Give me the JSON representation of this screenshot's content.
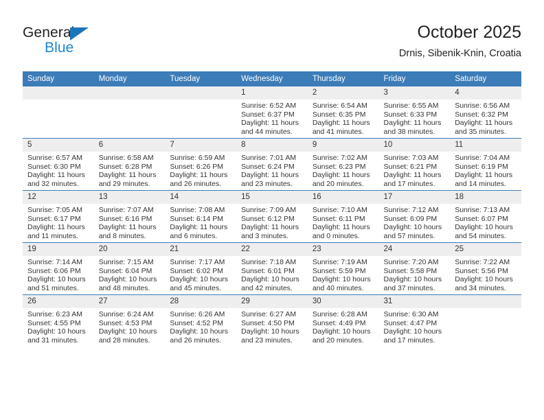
{
  "brand": {
    "name_part1": "General",
    "name_part2": "Blue",
    "triangle_color": "#1b75bb",
    "blue_color": "#1b86d6"
  },
  "header": {
    "title": "October 2025",
    "location": "Drnis, Sibenik-Knin, Croatia"
  },
  "theme": {
    "header_bg": "#3c7cb8",
    "daynum_bg": "#eeeeee",
    "row_border": "#3c7cb8",
    "text": "#333333"
  },
  "weekday_headers": [
    "Sunday",
    "Monday",
    "Tuesday",
    "Wednesday",
    "Thursday",
    "Friday",
    "Saturday"
  ],
  "labels": {
    "sunrise": "Sunrise:",
    "sunset": "Sunset:",
    "daylight": "Daylight:"
  },
  "weeks": [
    [
      {
        "day": "",
        "sunrise": "",
        "sunset": "",
        "daylight": ""
      },
      {
        "day": "",
        "sunrise": "",
        "sunset": "",
        "daylight": ""
      },
      {
        "day": "",
        "sunrise": "",
        "sunset": "",
        "daylight": ""
      },
      {
        "day": "1",
        "sunrise": "Sunrise: 6:52 AM",
        "sunset": "Sunset: 6:37 PM",
        "daylight": "Daylight: 11 hours and 44 minutes."
      },
      {
        "day": "2",
        "sunrise": "Sunrise: 6:54 AM",
        "sunset": "Sunset: 6:35 PM",
        "daylight": "Daylight: 11 hours and 41 minutes."
      },
      {
        "day": "3",
        "sunrise": "Sunrise: 6:55 AM",
        "sunset": "Sunset: 6:33 PM",
        "daylight": "Daylight: 11 hours and 38 minutes."
      },
      {
        "day": "4",
        "sunrise": "Sunrise: 6:56 AM",
        "sunset": "Sunset: 6:32 PM",
        "daylight": "Daylight: 11 hours and 35 minutes."
      }
    ],
    [
      {
        "day": "5",
        "sunrise": "Sunrise: 6:57 AM",
        "sunset": "Sunset: 6:30 PM",
        "daylight": "Daylight: 11 hours and 32 minutes."
      },
      {
        "day": "6",
        "sunrise": "Sunrise: 6:58 AM",
        "sunset": "Sunset: 6:28 PM",
        "daylight": "Daylight: 11 hours and 29 minutes."
      },
      {
        "day": "7",
        "sunrise": "Sunrise: 6:59 AM",
        "sunset": "Sunset: 6:26 PM",
        "daylight": "Daylight: 11 hours and 26 minutes."
      },
      {
        "day": "8",
        "sunrise": "Sunrise: 7:01 AM",
        "sunset": "Sunset: 6:24 PM",
        "daylight": "Daylight: 11 hours and 23 minutes."
      },
      {
        "day": "9",
        "sunrise": "Sunrise: 7:02 AM",
        "sunset": "Sunset: 6:23 PM",
        "daylight": "Daylight: 11 hours and 20 minutes."
      },
      {
        "day": "10",
        "sunrise": "Sunrise: 7:03 AM",
        "sunset": "Sunset: 6:21 PM",
        "daylight": "Daylight: 11 hours and 17 minutes."
      },
      {
        "day": "11",
        "sunrise": "Sunrise: 7:04 AM",
        "sunset": "Sunset: 6:19 PM",
        "daylight": "Daylight: 11 hours and 14 minutes."
      }
    ],
    [
      {
        "day": "12",
        "sunrise": "Sunrise: 7:05 AM",
        "sunset": "Sunset: 6:17 PM",
        "daylight": "Daylight: 11 hours and 11 minutes."
      },
      {
        "day": "13",
        "sunrise": "Sunrise: 7:07 AM",
        "sunset": "Sunset: 6:16 PM",
        "daylight": "Daylight: 11 hours and 8 minutes."
      },
      {
        "day": "14",
        "sunrise": "Sunrise: 7:08 AM",
        "sunset": "Sunset: 6:14 PM",
        "daylight": "Daylight: 11 hours and 6 minutes."
      },
      {
        "day": "15",
        "sunrise": "Sunrise: 7:09 AM",
        "sunset": "Sunset: 6:12 PM",
        "daylight": "Daylight: 11 hours and 3 minutes."
      },
      {
        "day": "16",
        "sunrise": "Sunrise: 7:10 AM",
        "sunset": "Sunset: 6:11 PM",
        "daylight": "Daylight: 11 hours and 0 minutes."
      },
      {
        "day": "17",
        "sunrise": "Sunrise: 7:12 AM",
        "sunset": "Sunset: 6:09 PM",
        "daylight": "Daylight: 10 hours and 57 minutes."
      },
      {
        "day": "18",
        "sunrise": "Sunrise: 7:13 AM",
        "sunset": "Sunset: 6:07 PM",
        "daylight": "Daylight: 10 hours and 54 minutes."
      }
    ],
    [
      {
        "day": "19",
        "sunrise": "Sunrise: 7:14 AM",
        "sunset": "Sunset: 6:06 PM",
        "daylight": "Daylight: 10 hours and 51 minutes."
      },
      {
        "day": "20",
        "sunrise": "Sunrise: 7:15 AM",
        "sunset": "Sunset: 6:04 PM",
        "daylight": "Daylight: 10 hours and 48 minutes."
      },
      {
        "day": "21",
        "sunrise": "Sunrise: 7:17 AM",
        "sunset": "Sunset: 6:02 PM",
        "daylight": "Daylight: 10 hours and 45 minutes."
      },
      {
        "day": "22",
        "sunrise": "Sunrise: 7:18 AM",
        "sunset": "Sunset: 6:01 PM",
        "daylight": "Daylight: 10 hours and 42 minutes."
      },
      {
        "day": "23",
        "sunrise": "Sunrise: 7:19 AM",
        "sunset": "Sunset: 5:59 PM",
        "daylight": "Daylight: 10 hours and 40 minutes."
      },
      {
        "day": "24",
        "sunrise": "Sunrise: 7:20 AM",
        "sunset": "Sunset: 5:58 PM",
        "daylight": "Daylight: 10 hours and 37 minutes."
      },
      {
        "day": "25",
        "sunrise": "Sunrise: 7:22 AM",
        "sunset": "Sunset: 5:56 PM",
        "daylight": "Daylight: 10 hours and 34 minutes."
      }
    ],
    [
      {
        "day": "26",
        "sunrise": "Sunrise: 6:23 AM",
        "sunset": "Sunset: 4:55 PM",
        "daylight": "Daylight: 10 hours and 31 minutes."
      },
      {
        "day": "27",
        "sunrise": "Sunrise: 6:24 AM",
        "sunset": "Sunset: 4:53 PM",
        "daylight": "Daylight: 10 hours and 28 minutes."
      },
      {
        "day": "28",
        "sunrise": "Sunrise: 6:26 AM",
        "sunset": "Sunset: 4:52 PM",
        "daylight": "Daylight: 10 hours and 26 minutes."
      },
      {
        "day": "29",
        "sunrise": "Sunrise: 6:27 AM",
        "sunset": "Sunset: 4:50 PM",
        "daylight": "Daylight: 10 hours and 23 minutes."
      },
      {
        "day": "30",
        "sunrise": "Sunrise: 6:28 AM",
        "sunset": "Sunset: 4:49 PM",
        "daylight": "Daylight: 10 hours and 20 minutes."
      },
      {
        "day": "31",
        "sunrise": "Sunrise: 6:30 AM",
        "sunset": "Sunset: 4:47 PM",
        "daylight": "Daylight: 10 hours and 17 minutes."
      },
      {
        "day": "",
        "sunrise": "",
        "sunset": "",
        "daylight": ""
      }
    ]
  ]
}
